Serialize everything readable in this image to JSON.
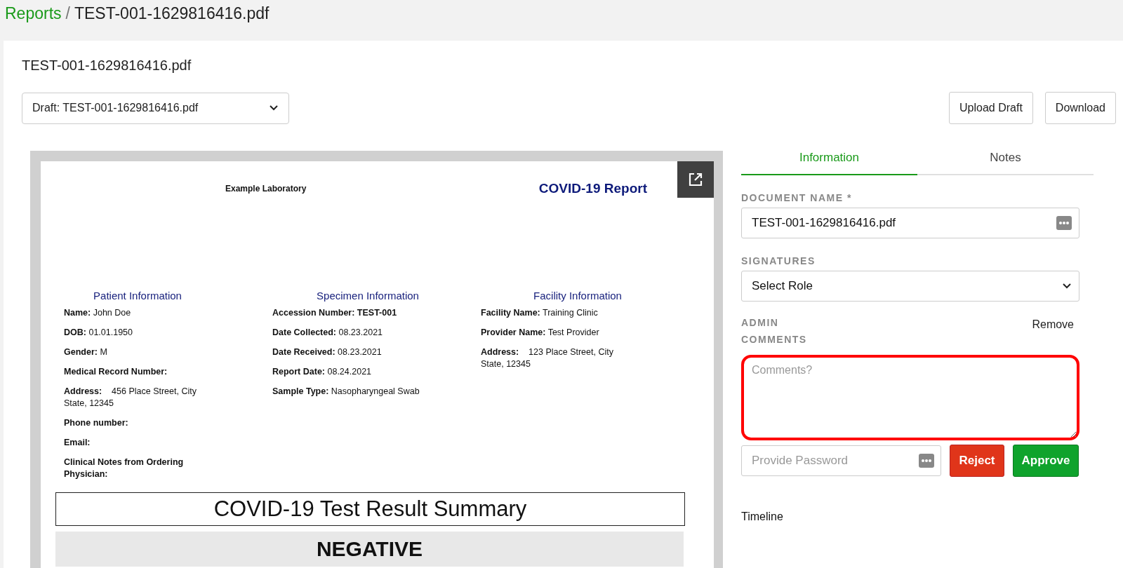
{
  "breadcrumb": {
    "link": "Reports",
    "separator": "/",
    "current": "TEST-001-1629816416.pdf"
  },
  "document_title": "TEST-001-1629816416.pdf",
  "version_select": {
    "value": "Draft: TEST-001-1629816416.pdf"
  },
  "actions": [
    "Upload Draft",
    "Download"
  ],
  "report": {
    "lab_name": "Example Laboratory",
    "title": "COVID-19 Report",
    "sections": [
      {
        "heading": "Patient Information",
        "fields": [
          "**Name:** John Doe",
          "**DOB:** 01.01.1950",
          "**Gender:** M",
          "**Medical Record Number:**",
          "**Address:**    456 Place Street, City State, 12345",
          "**Phone number:**",
          "**Email:**",
          "**Clinical Notes from Ordering Physician:**"
        ]
      },
      {
        "heading": "Specimen Information",
        "fields": [
          "**Accession Number: TEST-001**",
          "**Date Collected:** 08.23.2021",
          "**Date Received:** 08.23.2021",
          "**Report Date:** 08.24.2021",
          "**Sample Type:** Nasopharyngeal Swab"
        ]
      },
      {
        "heading": "Facility Information",
        "fields": [
          "**Facility Name:** Training Clinic",
          "**Provider Name:** Test Provider",
          "**Address:**    123 Place Street, City State, 12345"
        ]
      }
    ],
    "summary_title": "COVID-19 Test Result Summary",
    "result": "NEGATIVE"
  },
  "tabs": [
    {
      "label": "Information",
      "selected": true
    },
    {
      "label": "Notes",
      "selected": false
    }
  ],
  "document_name": {
    "label": "DOCUMENT NAME *",
    "value": "TEST-001-1629816416.pdf"
  },
  "signatures": {
    "label": "SIGNATURES",
    "value": "Select Role"
  },
  "admin_comments": {
    "label": "ADMIN COMMENTS",
    "remove": "Remove",
    "placeholder": "Comments?",
    "highlighted": true
  },
  "password": {
    "placeholder": "Provide Password"
  },
  "decision_buttons": [
    {
      "label": "Reject",
      "kind": "reject"
    },
    {
      "label": "Approve",
      "kind": "approve"
    }
  ],
  "timeline": "Timeline"
}
